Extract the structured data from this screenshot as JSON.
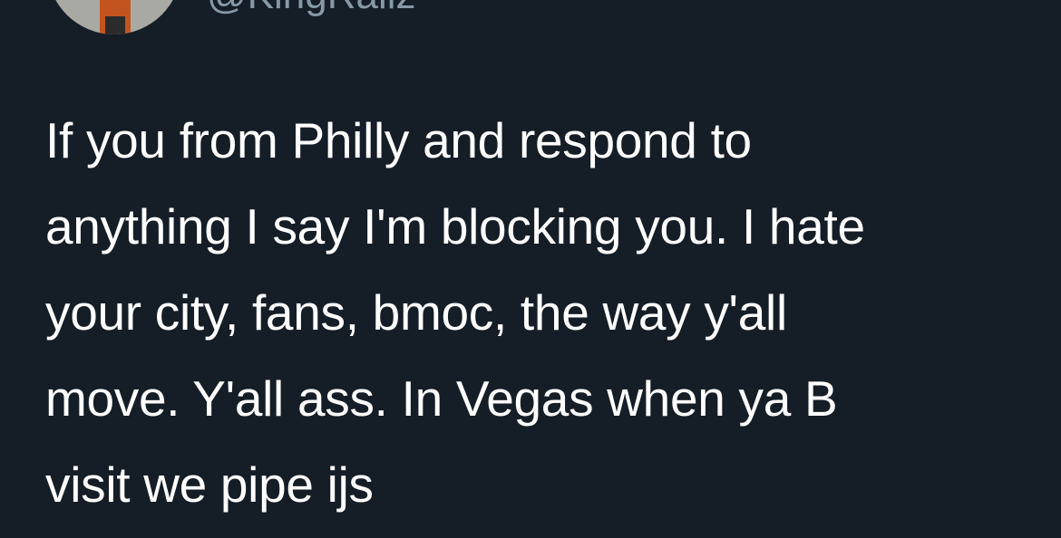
{
  "tweet": {
    "handle": "@KingRallz",
    "lines": [
      "If you from Philly and respond to",
      "anything I say I'm blocking you. I hate",
      "your city, fans, bmoc, the way y'all",
      "move. Y'all ass. In Vegas when ya B",
      "visit we pipe ijs"
    ]
  },
  "colors": {
    "background": "#151e27",
    "text": "#ffffff",
    "handle": "#8899a6"
  }
}
